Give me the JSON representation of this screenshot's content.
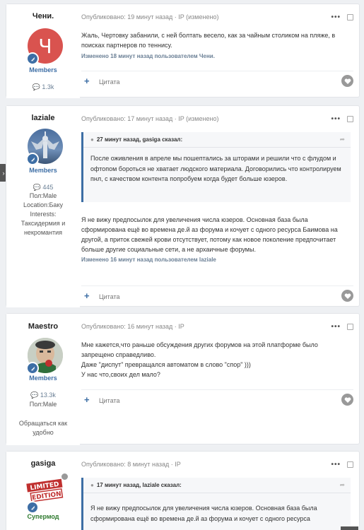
{
  "posts": [
    {
      "author": "Чени.",
      "avatar_letter": "Ч",
      "avatar_color": "#d9534f",
      "group": "Members",
      "count": "1.3k",
      "posted": "Опубликовано: 19 минут назад · IP",
      "changed": "(изменено)",
      "body": "Жаль, Чертовку забанили, с ней болтать весело, как за чайным столиком на пляже, в поисках партнеров по теннису.",
      "edited": "Изменено 18 минут назад пользователем Чени.",
      "cite": "Цитата"
    },
    {
      "author": "laziale",
      "group": "Members",
      "count": "445",
      "gender": "Пол:Male",
      "location": "Location:Баку",
      "interests_label": "Interests:",
      "interests": "Таксидермия и некромантия",
      "posted": "Опубликовано: 17 минут назад · IP",
      "changed": "(изменено)",
      "quote_head": "27 минут назад, gasiga сказал:",
      "quote_body": "После оживления в апреле мы пошептались за шторами и решили что с флудом и офтопом бороться не хватает людского материала. Договорились что контролируем пнл, с качеством контента попробуем когда будет больше юзеров.",
      "body": "Я не вижу предпосылок для увеличения числа юзеров. Основная база была сформирована ещё во времена де.й аз форума и кочует с одного ресурса Баимова на другой, а приток свежей крови отсутствует, потому как новое поколение предпочитает больше другие социальные сети, а не архаичные форумы.",
      "edited": "Изменено 16 минут назад пользователем laziale",
      "cite": "Цитата"
    },
    {
      "author": "Maestro",
      "group": "Members",
      "count": "13.3k",
      "gender": "Пол:Male",
      "status": "Обращаться как удобно",
      "posted": "Опубликовано: 16 минут назад · IP",
      "body_lines": [
        "Мне кажется,что раньше обсуждения других форумов на этой платформе было запрещено справедливо.",
        "Даже \"диспут\" превращался автоматом в слово \"спор\" )))",
        "У нас что,своих дел мало?"
      ],
      "cite": "Цитата"
    },
    {
      "author": "gasiga",
      "group": "Супермод",
      "avatar_text_1": "LIMITED",
      "avatar_text_2": "EDITION",
      "posted": "Опубликовано: 8 минут назад · IP",
      "quote_head": "17 минут назад, laziale сказал:",
      "quote_body": "Я не вижу предпосылок для увеличения числа юзеров. Основная база была сформирована ещё во времена де.й аз форума и кочует с одного ресурса"
    }
  ],
  "colors": {
    "accent": "#3d6ea5",
    "supermod": "#2f7a2f"
  },
  "icons": {
    "menu": "ellipsis-icon",
    "like": "heart-icon",
    "add": "plus-icon"
  }
}
